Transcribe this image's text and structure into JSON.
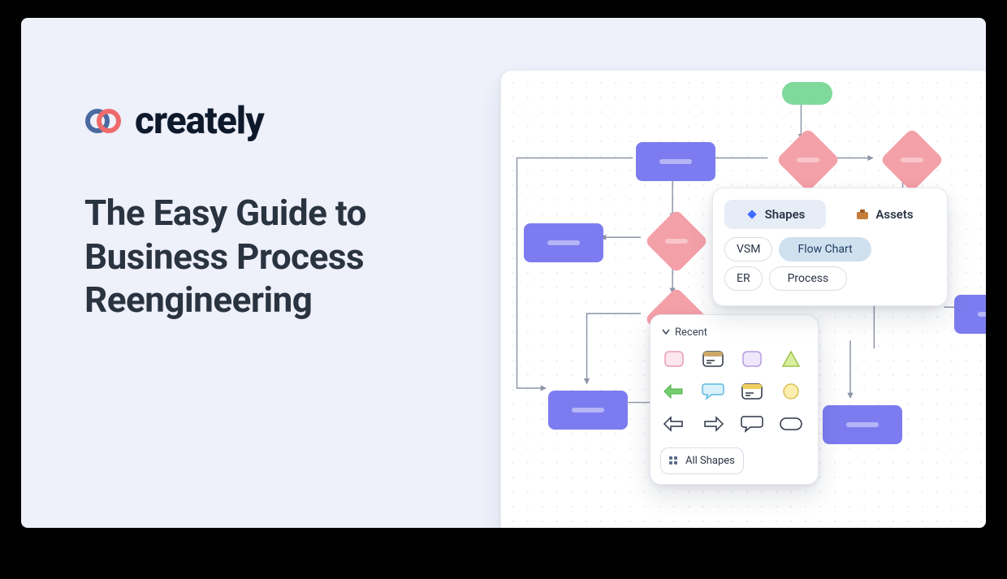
{
  "brand": {
    "name": "creately"
  },
  "headline": "The Easy Guide to Business Process Reengineering",
  "popover": {
    "tabs": {
      "shapes": "Shapes",
      "assets": "Assets"
    },
    "chips": {
      "vsm": "VSM",
      "flowchart": "Flow Chart",
      "er": "ER",
      "process": "Process"
    }
  },
  "recent": {
    "label": "Recent",
    "all_shapes": "All Shapes"
  }
}
